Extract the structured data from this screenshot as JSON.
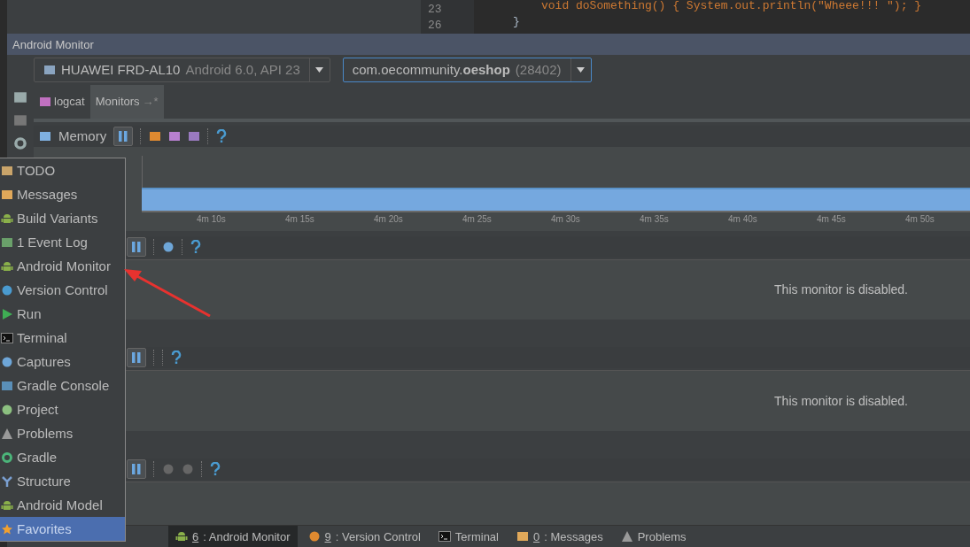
{
  "editor": {
    "lines": [
      {
        "number": "23",
        "code": "void doSomething() { System.out.println(\"Wheee!!! \"); }"
      },
      {
        "number": "26",
        "code": "}"
      }
    ]
  },
  "tool_window": {
    "title": "Android Monitor"
  },
  "device_selector": {
    "device": "HUAWEI FRD-AL10",
    "detail": "Android 6.0, API 23"
  },
  "process_selector": {
    "package": "com.oecommunity.**oeshop**",
    "pid": "(28402)"
  },
  "tabs": [
    {
      "label": "logcat",
      "selected": false
    },
    {
      "label": "Monitors",
      "suffix": "→*",
      "selected": true
    }
  ],
  "monitors": [
    {
      "kind": "memory",
      "title": "Memory",
      "ticks": [
        "4m 10s",
        "4m 15s",
        "4m 20s",
        "4m 25s",
        "4m 30s",
        "4m 35s",
        "4m 40s",
        "4m 45s",
        "4m 50s"
      ]
    },
    {
      "kind": "timer",
      "message": "This monitor is disabled."
    },
    {
      "kind": "plain",
      "message": "This monitor is disabled."
    },
    {
      "kind": "record"
    }
  ],
  "popup_menu": {
    "items": [
      {
        "label": "TODO",
        "selected": false
      },
      {
        "label": "Messages",
        "selected": false
      },
      {
        "label": "Build Variants",
        "selected": false
      },
      {
        "label": "Event Log",
        "badge": "1",
        "selected": false
      },
      {
        "label": "Android Monitor",
        "selected": false
      },
      {
        "label": "Version Control",
        "selected": false
      },
      {
        "label": "Run",
        "selected": false
      },
      {
        "label": "Terminal",
        "selected": false
      },
      {
        "label": "Captures",
        "selected": false
      },
      {
        "label": "Gradle Console",
        "selected": false
      },
      {
        "label": "Project",
        "selected": false
      },
      {
        "label": "Problems",
        "selected": false
      },
      {
        "label": "Gradle",
        "selected": false
      },
      {
        "label": "Structure",
        "selected": false
      },
      {
        "label": "Android Model",
        "selected": false
      },
      {
        "label": "Favorites",
        "selected": true
      }
    ]
  },
  "bottom_tabs": [
    {
      "key": "6",
      "label": ": Android Monitor",
      "selected": true
    },
    {
      "key": "9",
      "label": ": Version Control",
      "selected": false
    },
    {
      "label": "Terminal",
      "selected": false
    },
    {
      "key": "0",
      "label": ": Messages",
      "selected": false
    },
    {
      "label": "Problems",
      "selected": false
    }
  ]
}
